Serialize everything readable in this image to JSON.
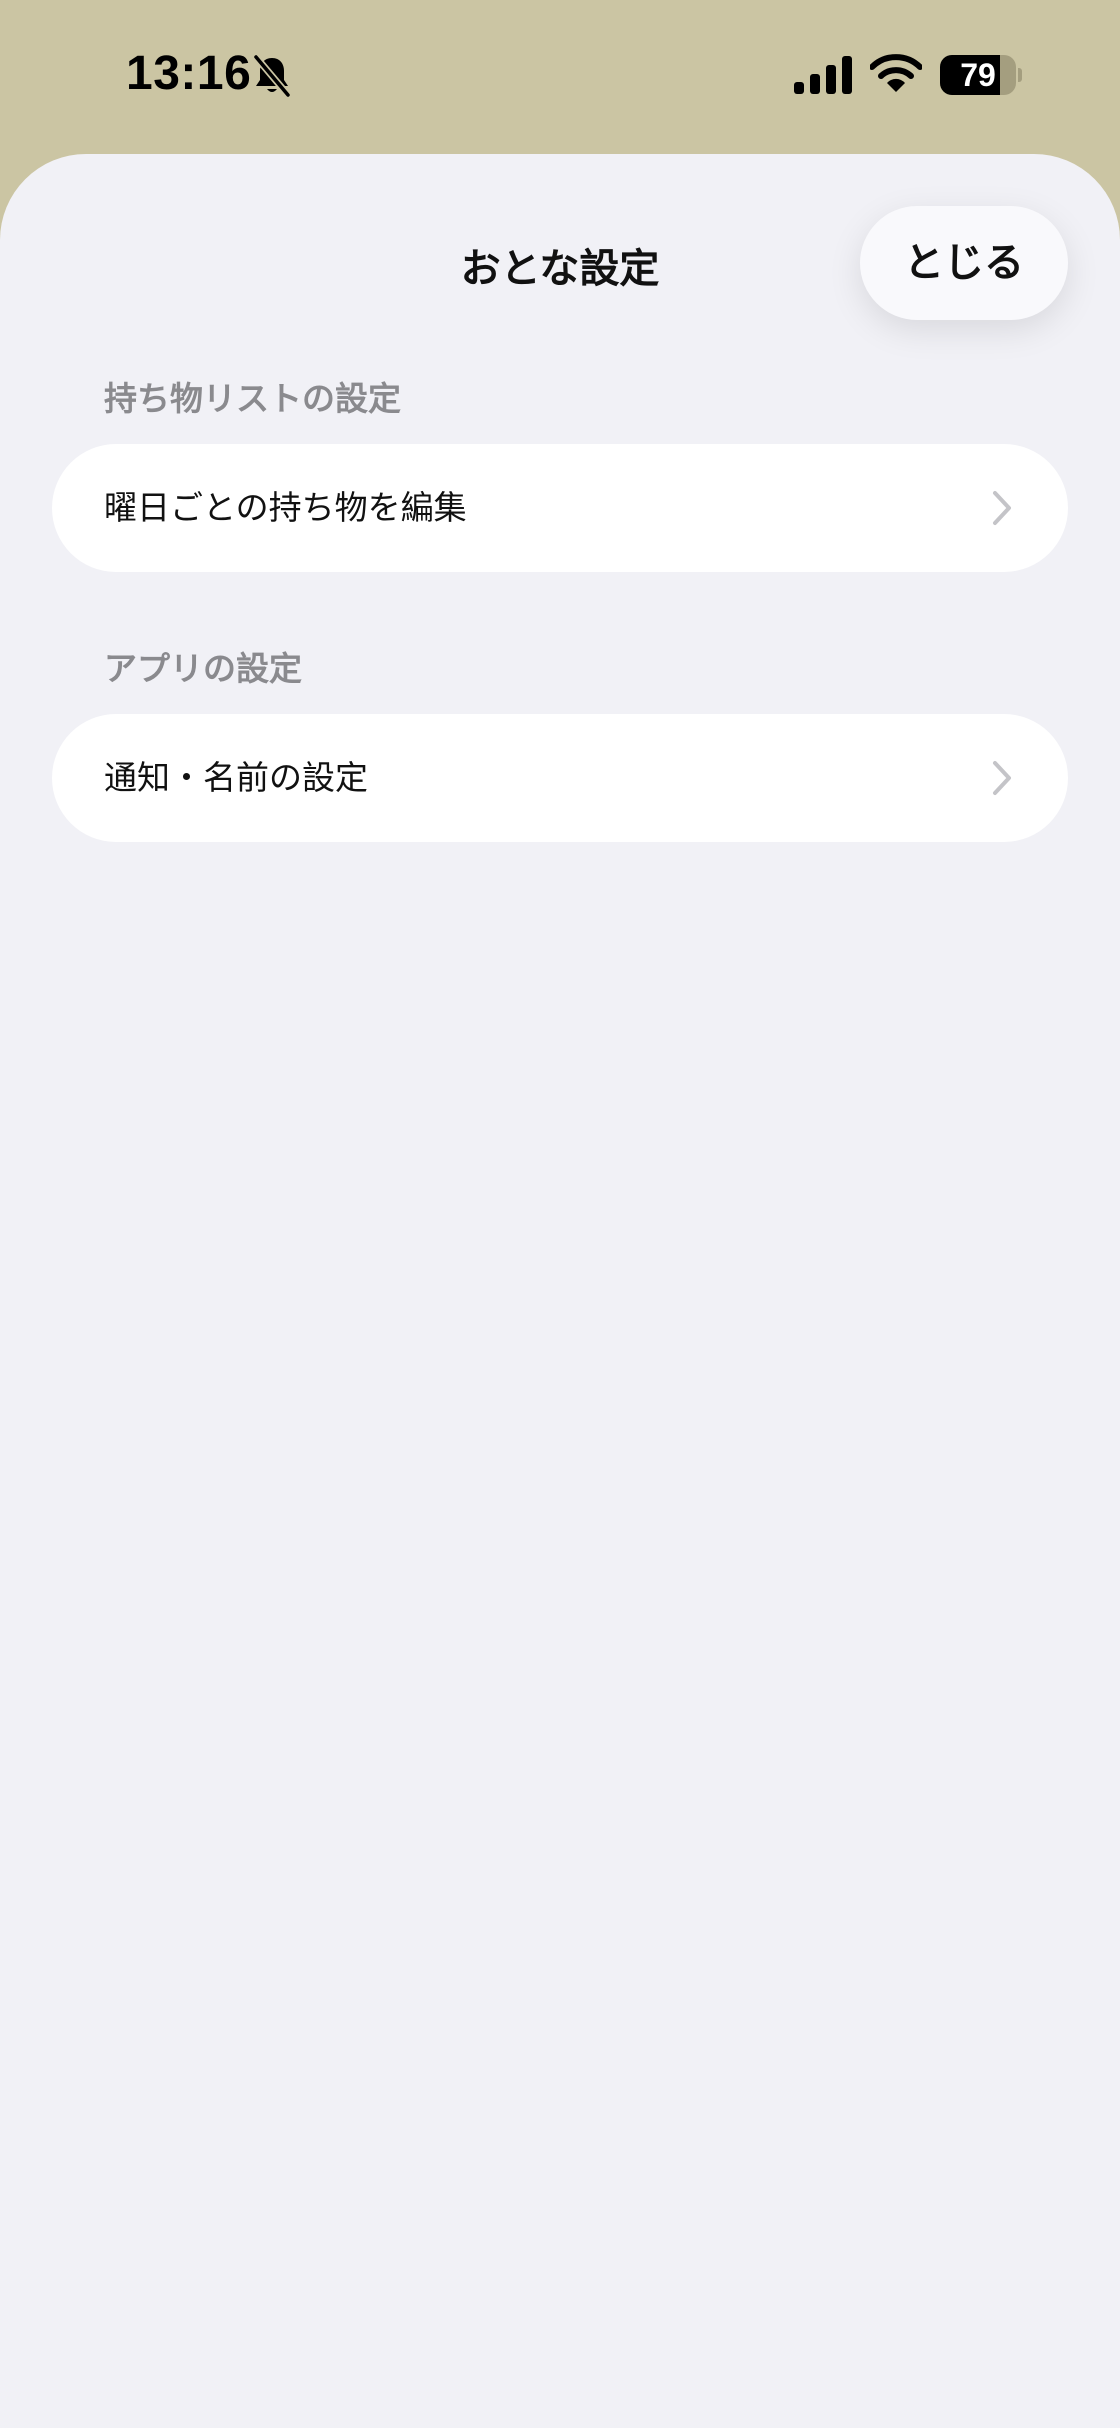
{
  "status_bar": {
    "time": "13:16",
    "battery_level": "79",
    "battery_percent": 79,
    "icons": [
      "bell-slash-icon",
      "cellular-signal-icon",
      "wifi-icon",
      "battery-icon"
    ]
  },
  "sheet": {
    "title": "おとな設定",
    "close_label": "とじる"
  },
  "sections": [
    {
      "header": "持ち物リストの設定",
      "items": [
        {
          "label": "曜日ごとの持ち物を編集",
          "icon": "chevron-right-icon"
        }
      ]
    },
    {
      "header": "アプリの設定",
      "items": [
        {
          "label": "通知・名前の設定",
          "icon": "chevron-right-icon"
        }
      ]
    }
  ],
  "colors": {
    "backdrop": "#cbc5a3",
    "sheet_background": "#f1f1f6",
    "row_background": "#ffffff",
    "section_header_text": "#8a8a8e",
    "chevron": "#c4c4c8"
  }
}
